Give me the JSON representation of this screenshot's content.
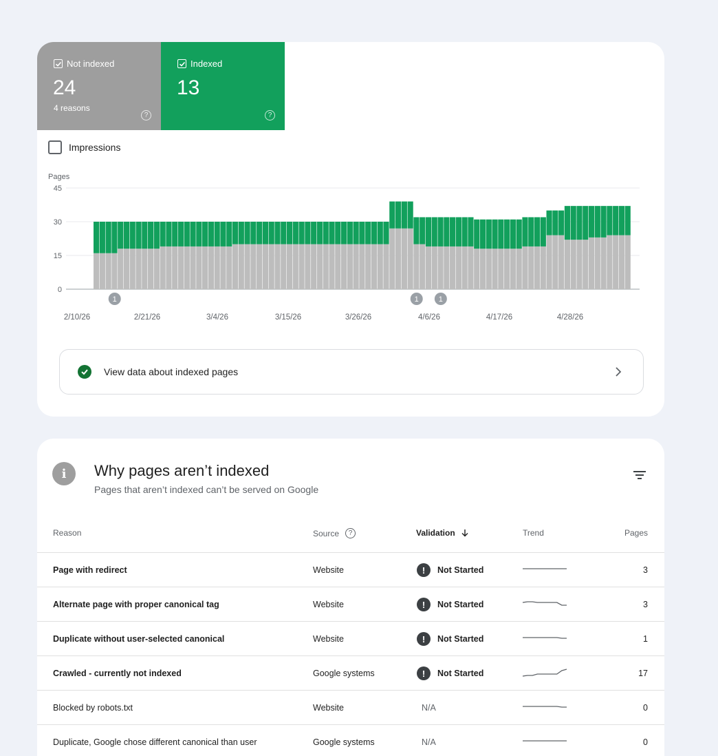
{
  "tiles": {
    "not_indexed": {
      "label": "Not indexed",
      "count": "24",
      "sub": "4 reasons",
      "color": "#9e9e9e"
    },
    "indexed": {
      "label": "Indexed",
      "count": "13",
      "color": "#12a05c"
    }
  },
  "impressions_label": "Impressions",
  "chart_data": {
    "type": "bar",
    "stacked": true,
    "ylabel": "Pages",
    "ylim": [
      0,
      45
    ],
    "yticks": [
      "45",
      "30",
      "15",
      "0"
    ],
    "xtick_labels": [
      "2/10/26",
      "2/21/26",
      "3/4/26",
      "3/15/26",
      "3/26/26",
      "4/6/26",
      "4/17/26",
      "4/28/26"
    ],
    "series": [
      {
        "name": "Not indexed",
        "color": "#bdbdbd",
        "values": [
          16,
          16,
          16,
          16,
          18,
          18,
          18,
          18,
          18,
          18,
          18,
          19,
          19,
          19,
          19,
          19,
          19,
          19,
          19,
          19,
          19,
          19,
          19,
          20,
          20,
          20,
          20,
          20,
          20,
          20,
          20,
          20,
          20,
          20,
          20,
          20,
          20,
          20,
          20,
          20,
          20,
          20,
          20,
          20,
          20,
          20,
          20,
          20,
          20,
          27,
          27,
          27,
          27,
          20,
          20,
          19,
          19,
          19,
          19,
          19,
          19,
          19,
          19,
          18,
          18,
          18,
          18,
          18,
          18,
          18,
          18,
          19,
          19,
          19,
          19,
          24,
          24,
          24,
          22,
          22,
          22,
          22,
          23,
          23,
          23,
          24,
          24,
          24,
          24
        ]
      },
      {
        "name": "Indexed",
        "color": "#12a05c",
        "values": [
          14,
          14,
          14,
          14,
          12,
          12,
          12,
          12,
          12,
          12,
          12,
          11,
          11,
          11,
          11,
          11,
          11,
          11,
          11,
          11,
          11,
          11,
          11,
          10,
          10,
          10,
          10,
          10,
          10,
          10,
          10,
          10,
          10,
          10,
          10,
          10,
          10,
          10,
          10,
          10,
          10,
          10,
          10,
          10,
          10,
          10,
          10,
          10,
          10,
          12,
          12,
          12,
          12,
          12,
          12,
          13,
          13,
          13,
          13,
          13,
          13,
          13,
          13,
          13,
          13,
          13,
          13,
          13,
          13,
          13,
          13,
          13,
          13,
          13,
          13,
          11,
          11,
          11,
          15,
          15,
          15,
          15,
          14,
          14,
          14,
          13,
          13,
          13,
          13
        ]
      }
    ],
    "annotations": [
      {
        "label": "1",
        "index": 3
      },
      {
        "label": "1",
        "index": 53
      },
      {
        "label": "1",
        "index": 57
      }
    ]
  },
  "view_link": "View data about indexed pages",
  "section": {
    "title": "Why pages aren’t indexed",
    "subtitle": "Pages that aren’t indexed can’t be served on Google"
  },
  "columns": {
    "reason": "Reason",
    "source": "Source",
    "validation": "Validation",
    "trend": "Trend",
    "pages": "Pages"
  },
  "rows": [
    {
      "reason": "Page with redirect",
      "source": "Website",
      "validation": "Not Started",
      "pages": "3",
      "trend": [
        5,
        5,
        5,
        5,
        5,
        5,
        5,
        5,
        5,
        5
      ]
    },
    {
      "reason": "Alternate page with proper canonical tag",
      "source": "Website",
      "validation": "Not Started",
      "pages": "3",
      "trend": [
        4,
        3,
        3,
        4,
        4,
        4,
        4,
        4,
        8,
        8
      ]
    },
    {
      "reason": "Duplicate without user-selected canonical",
      "source": "Website",
      "validation": "Not Started",
      "pages": "1",
      "trend": [
        5,
        5,
        5,
        5,
        5,
        5,
        5,
        5,
        6,
        6
      ]
    },
    {
      "reason": "Crawled - currently not indexed",
      "source": "Google systems",
      "validation": "Not Started",
      "pages": "17",
      "trend": [
        11,
        10,
        10,
        8,
        8,
        8,
        8,
        8,
        3,
        1
      ]
    },
    {
      "reason": "Blocked by robots.txt",
      "source": "Website",
      "validation": "N/A",
      "pages": "0",
      "trend": [
        5,
        5,
        5,
        5,
        5,
        5,
        5,
        5,
        6,
        6
      ]
    },
    {
      "reason": "Duplicate, Google chose different canonical than user",
      "source": "Google systems",
      "validation": "N/A",
      "pages": "0",
      "trend": [
        5,
        5,
        5,
        5,
        5,
        5,
        5,
        5,
        5,
        5
      ]
    }
  ]
}
